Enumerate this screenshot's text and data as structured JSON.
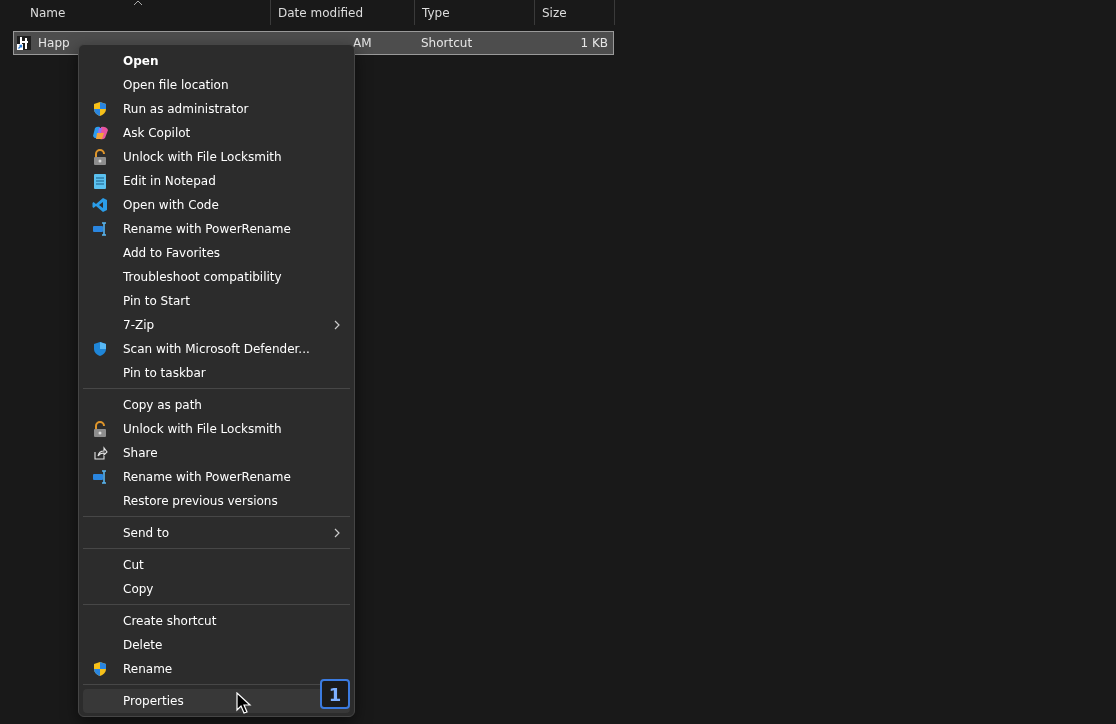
{
  "columns": [
    {
      "label": "Name",
      "sorted": true
    },
    {
      "label": "Date modified",
      "sorted": false
    },
    {
      "label": "Type",
      "sorted": false
    },
    {
      "label": "Size",
      "sorted": false
    }
  ],
  "files": [
    {
      "name": "Happ",
      "date_modified": "AM",
      "type": "Shortcut",
      "size": "1 KB",
      "selected": true
    }
  ],
  "context_menu": {
    "groups": [
      [
        {
          "label": "Open",
          "kind": "plain",
          "default": true,
          "submenu": false,
          "highlighted": false
        },
        {
          "label": "Open file location",
          "kind": "plain",
          "default": false,
          "submenu": false,
          "highlighted": false
        },
        {
          "label": "Run as administrator",
          "kind": "admin",
          "default": false,
          "submenu": false,
          "highlighted": false
        },
        {
          "label": "Ask Copilot",
          "kind": "copilot",
          "default": false,
          "submenu": false,
          "highlighted": false
        },
        {
          "label": "Unlock with File Locksmith",
          "kind": "locksmith",
          "default": false,
          "submenu": false,
          "highlighted": false
        },
        {
          "label": "Edit in Notepad",
          "kind": "notepad",
          "default": false,
          "submenu": false,
          "highlighted": false
        },
        {
          "label": "Open with Code",
          "kind": "code",
          "default": false,
          "submenu": false,
          "highlighted": false
        },
        {
          "label": "Rename with PowerRename",
          "kind": "powerrename",
          "default": false,
          "submenu": false,
          "highlighted": false
        },
        {
          "label": "Add to Favorites",
          "kind": "plain",
          "default": false,
          "submenu": false,
          "highlighted": false
        },
        {
          "label": "Troubleshoot compatibility",
          "kind": "plain",
          "default": false,
          "submenu": false,
          "highlighted": false
        },
        {
          "label": "Pin to Start",
          "kind": "plain",
          "default": false,
          "submenu": false,
          "highlighted": false
        },
        {
          "label": "7-Zip",
          "kind": "plain",
          "default": false,
          "submenu": true,
          "highlighted": false
        },
        {
          "label": "Scan with Microsoft Defender...",
          "kind": "defender",
          "default": false,
          "submenu": false,
          "highlighted": false
        },
        {
          "label": "Pin to taskbar",
          "kind": "plain",
          "default": false,
          "submenu": false,
          "highlighted": false
        }
      ],
      [
        {
          "label": "Copy as path",
          "kind": "plain",
          "default": false,
          "submenu": false,
          "highlighted": false
        },
        {
          "label": "Unlock with File Locksmith",
          "kind": "locksmith",
          "default": false,
          "submenu": false,
          "highlighted": false
        },
        {
          "label": "Share",
          "kind": "share",
          "default": false,
          "submenu": false,
          "highlighted": false
        },
        {
          "label": "Rename with PowerRename",
          "kind": "powerrename",
          "default": false,
          "submenu": false,
          "highlighted": false
        },
        {
          "label": "Restore previous versions",
          "kind": "plain",
          "default": false,
          "submenu": false,
          "highlighted": false
        }
      ],
      [
        {
          "label": "Send to",
          "kind": "plain",
          "default": false,
          "submenu": true,
          "highlighted": false
        }
      ],
      [
        {
          "label": "Cut",
          "kind": "plain",
          "default": false,
          "submenu": false,
          "highlighted": false
        },
        {
          "label": "Copy",
          "kind": "plain",
          "default": false,
          "submenu": false,
          "highlighted": false
        }
      ],
      [
        {
          "label": "Create shortcut",
          "kind": "plain",
          "default": false,
          "submenu": false,
          "highlighted": false
        },
        {
          "label": "Delete",
          "kind": "plain",
          "default": false,
          "submenu": false,
          "highlighted": false
        },
        {
          "label": "Rename",
          "kind": "admin",
          "default": false,
          "submenu": false,
          "highlighted": false
        }
      ],
      [
        {
          "label": "Properties",
          "kind": "plain",
          "default": false,
          "submenu": false,
          "highlighted": true
        }
      ]
    ]
  },
  "step_badge": "1"
}
